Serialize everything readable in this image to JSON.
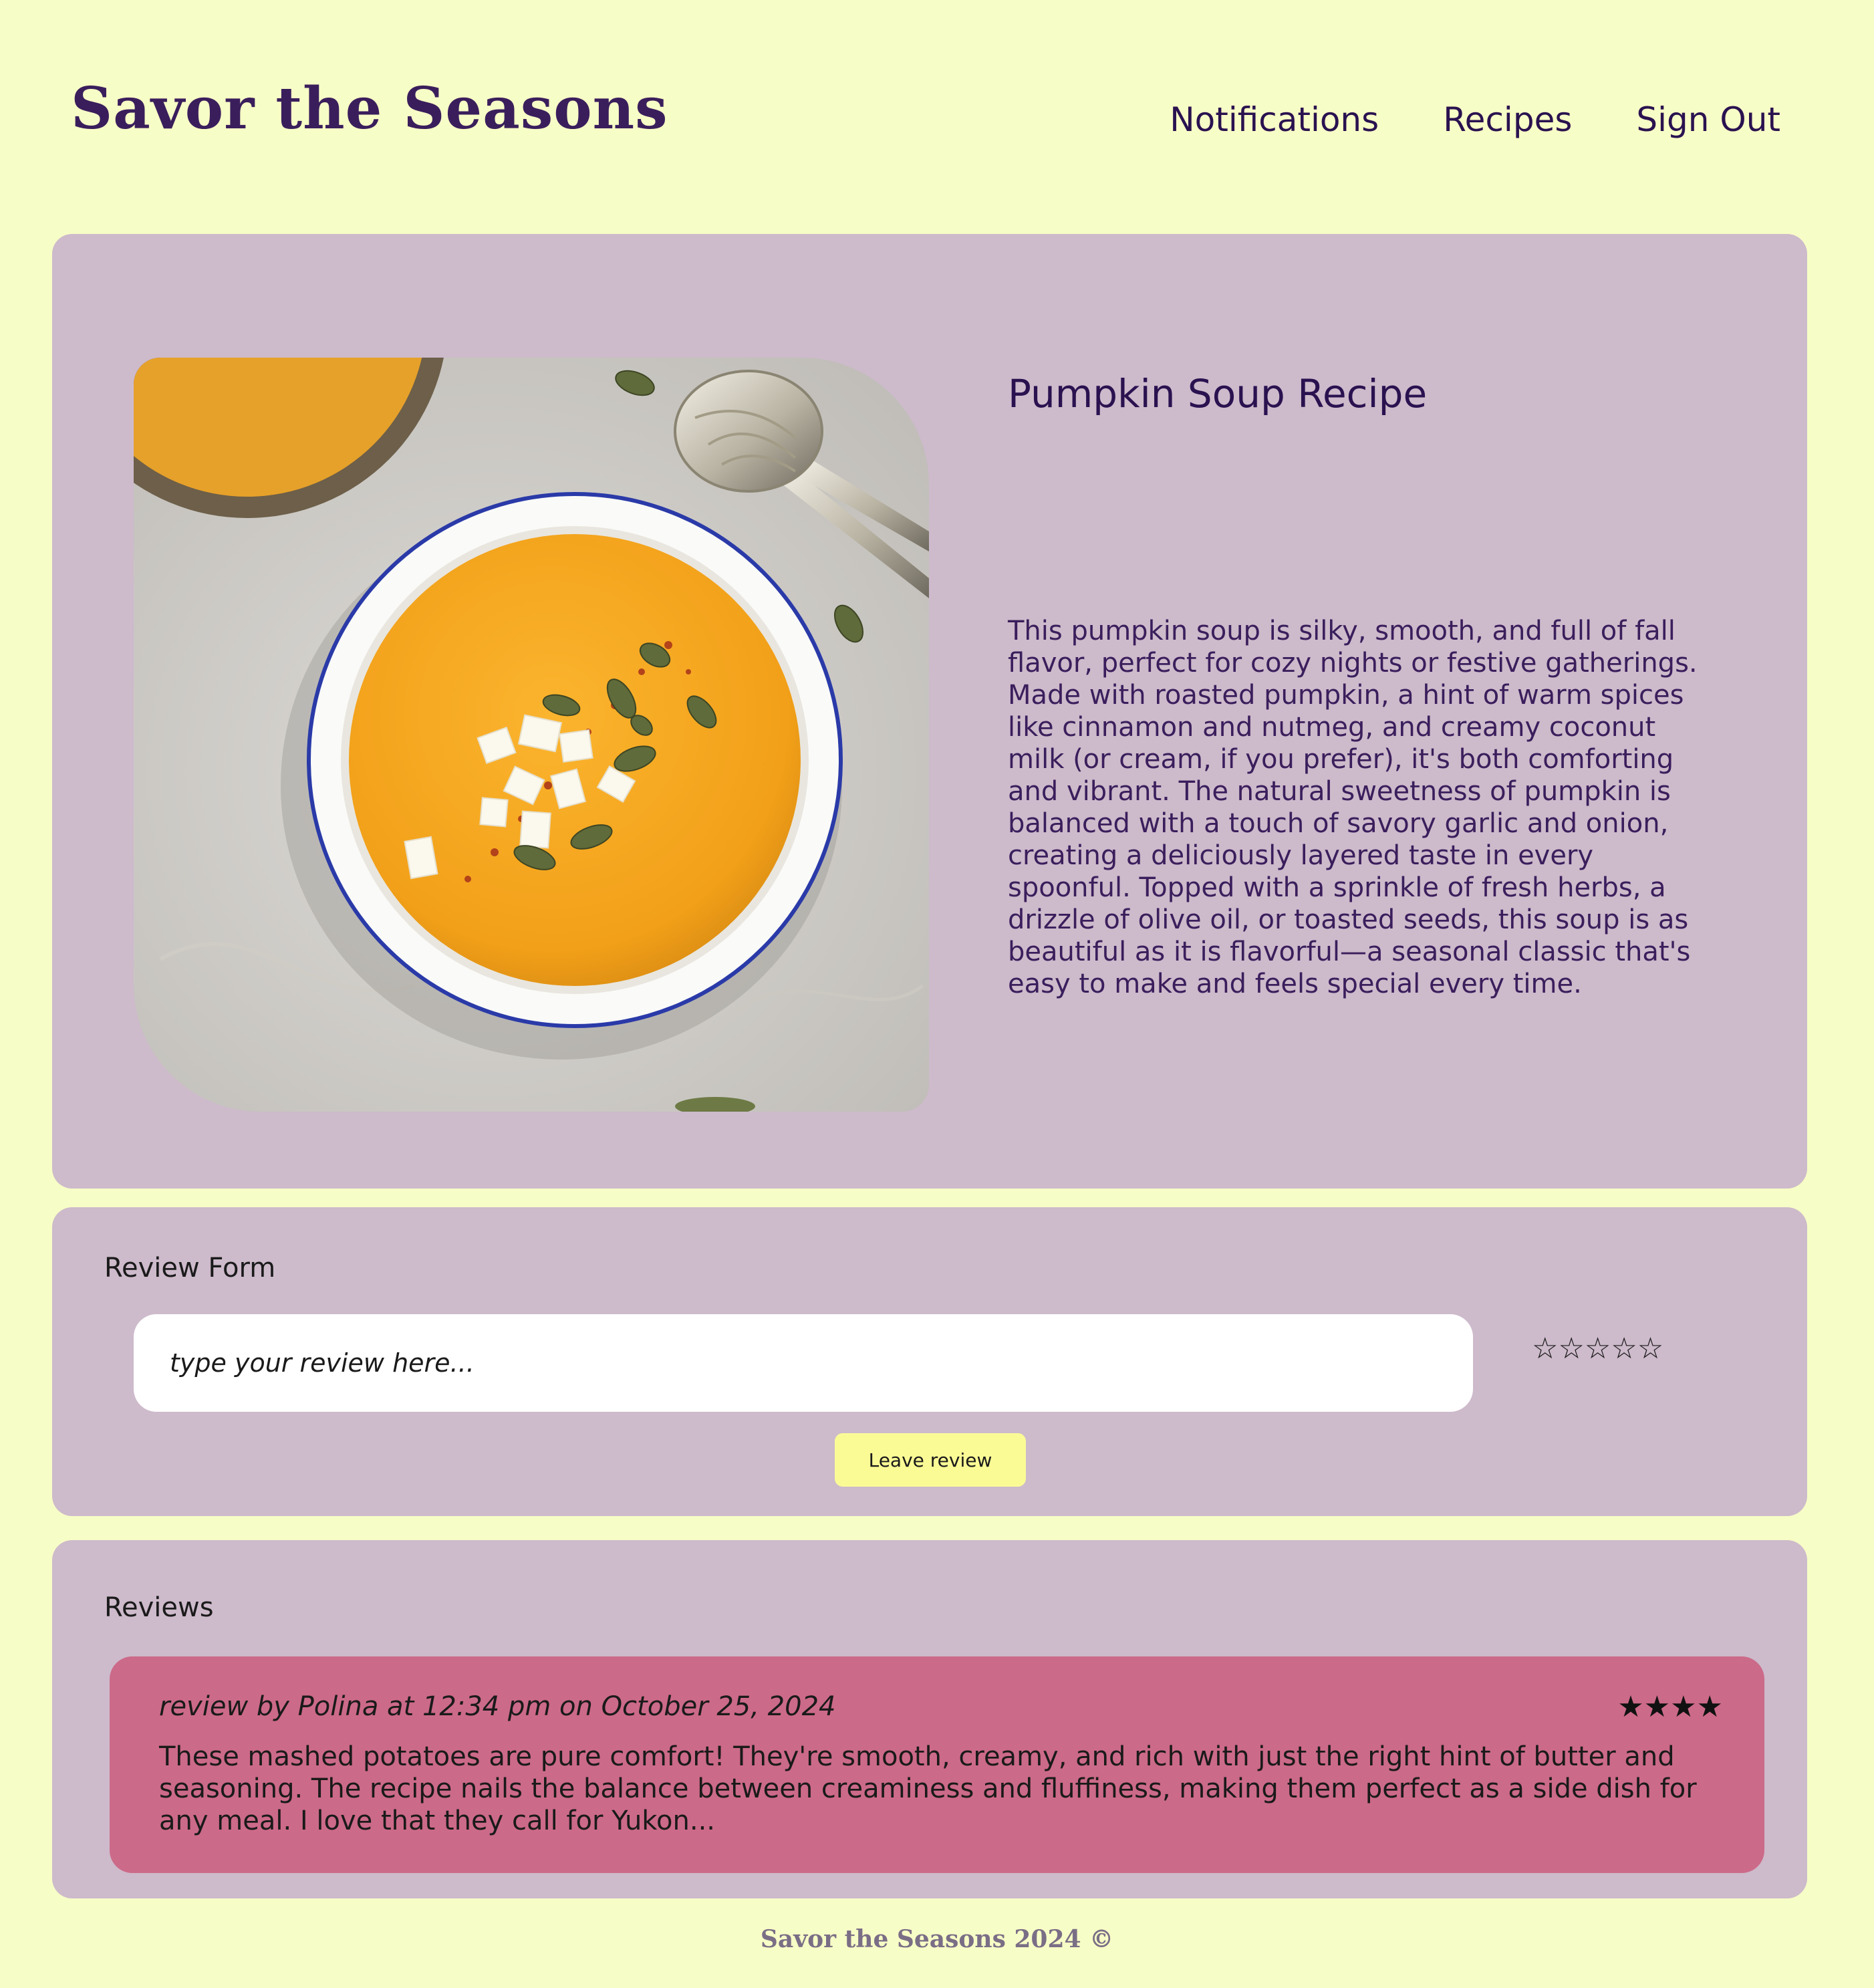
{
  "header": {
    "logo": "Savor the Seasons",
    "nav": [
      "Notifications",
      "Recipes",
      "Sign Out"
    ]
  },
  "recipe": {
    "title": "Pumpkin Soup Recipe",
    "description": "This pumpkin soup is silky, smooth, and full of fall flavor, perfect for cozy nights or festive gatherings. Made with roasted pumpkin, a hint of warm spices like cinnamon and nutmeg, and creamy coconut milk (or cream, if you prefer), it's both comforting and vibrant. The natural sweetness of pumpkin is balanced with a touch of savory garlic and onion, creating a deliciously layered taste in every spoonful. Topped with a sprinkle of fresh herbs, a drizzle of olive oil, or toasted seeds, this soup is as beautiful as it is flavorful—a seasonal classic that's easy to make and feels special every time."
  },
  "review_form": {
    "label": "Review Form",
    "placeholder": "type your review here...",
    "empty_stars": "☆☆☆☆☆",
    "submit_label": "Leave review"
  },
  "reviews": {
    "label": "Reviews",
    "items": [
      {
        "meta": "review by Polina at 12:34 pm on October 25, 2024",
        "rating": "★★★★",
        "body": "These mashed potatoes are pure comfort! They're smooth, creamy, and rich with just the right hint of butter and seasoning. The recipe nails the balance between creaminess and fluffiness, making them perfect as a side dish for any meal. I love that they call for Yukon..."
      }
    ]
  },
  "footer": {
    "text": "Savor the Seasons 2024 ©"
  },
  "colors": {
    "background": "#f7fdc6",
    "panel": "#cdbacb",
    "review_card": "#cc6a89",
    "button": "#fbfb96",
    "text_primary": "#2a1250"
  }
}
